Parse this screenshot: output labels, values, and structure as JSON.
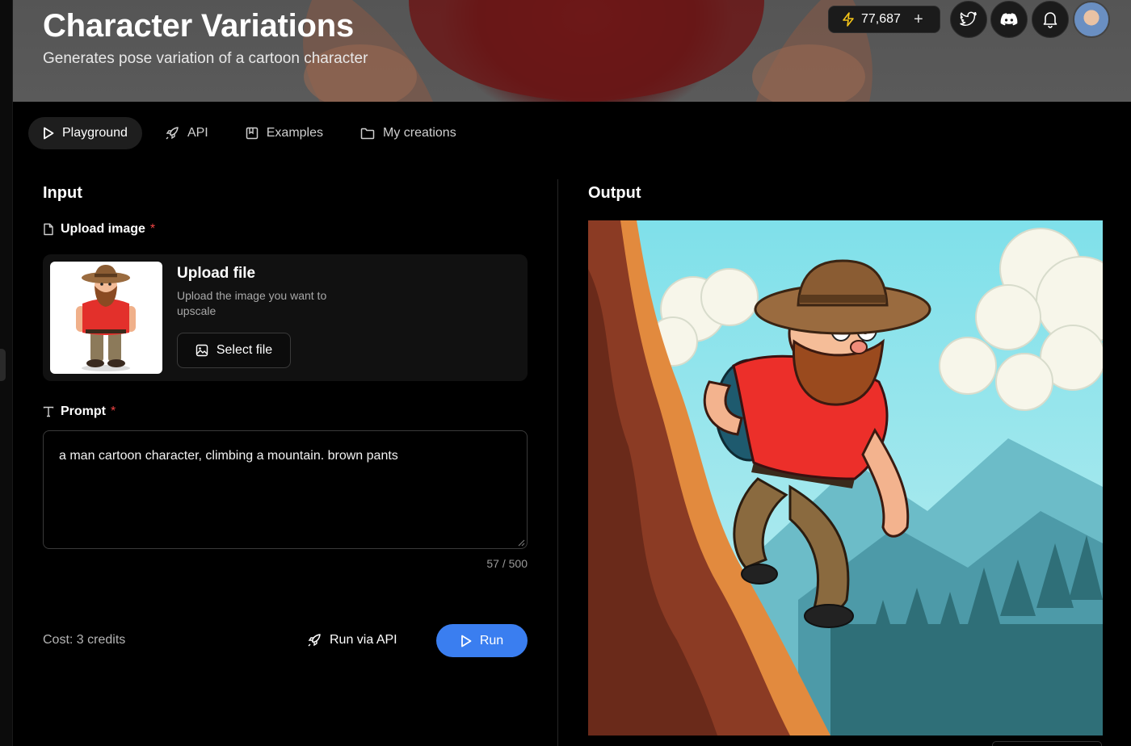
{
  "header": {
    "title": "Character Variations",
    "subtitle": "Generates pose variation of a cartoon character",
    "credits": "77,687",
    "credits_add": "+"
  },
  "tabs": [
    {
      "label": "Playground",
      "icon": "play-icon",
      "active": true
    },
    {
      "label": "API",
      "icon": "rocket-icon",
      "active": false
    },
    {
      "label": "Examples",
      "icon": "bookmark-icon",
      "active": false
    },
    {
      "label": "My creations",
      "icon": "folder-icon",
      "active": false
    }
  ],
  "input": {
    "title": "Input",
    "upload": {
      "label": "Upload image",
      "required_mark": "*",
      "title": "Upload file",
      "description": "Upload the image you want to upscale",
      "button": "Select file"
    },
    "prompt": {
      "label": "Prompt",
      "required_mark": "*",
      "value": "a man cartoon character, climbing a mountain. brown pants",
      "counter": "57 / 500"
    },
    "cost": "Cost: 3 credits",
    "run_via_api": "Run via API",
    "run": "Run"
  },
  "output": {
    "title": "Output"
  },
  "colors": {
    "accent": "#3a7ef0",
    "required": "#ef4444",
    "lightning": "#f5c518"
  }
}
